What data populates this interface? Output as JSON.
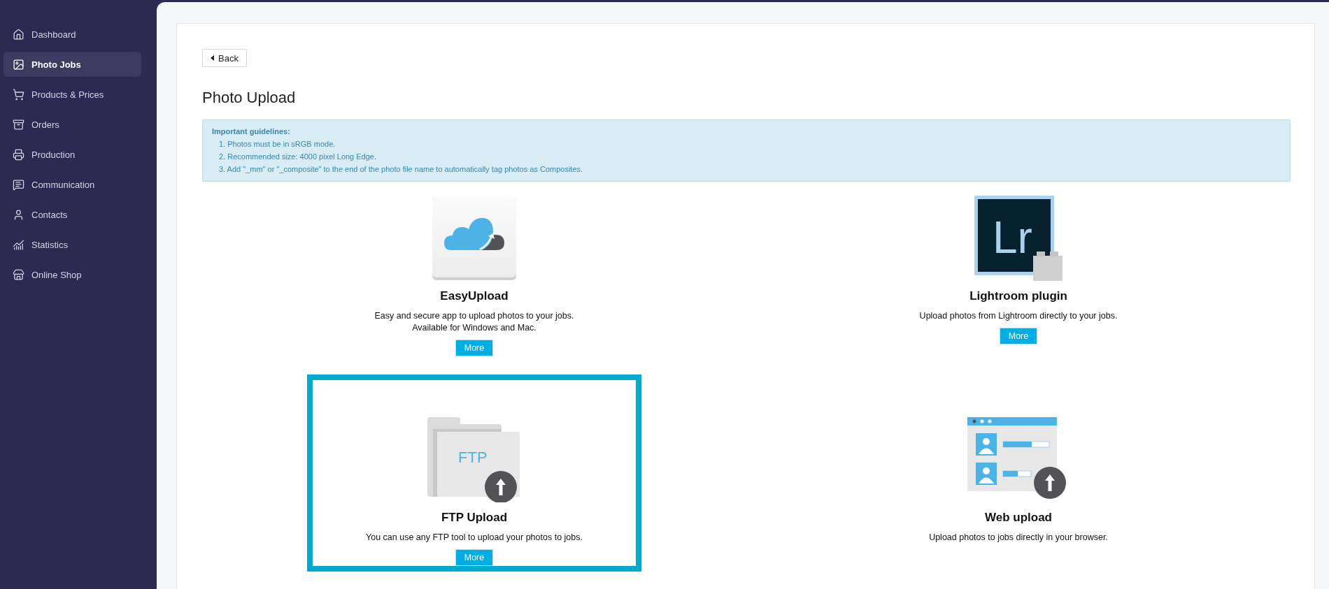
{
  "sidebar": {
    "items": [
      {
        "kind": "home",
        "label": "Dashboard",
        "selected": false
      },
      {
        "kind": "image",
        "label": "Photo Jobs",
        "selected": true
      },
      {
        "kind": "cart",
        "label": "Products & Prices",
        "selected": false
      },
      {
        "kind": "box",
        "label": "Orders",
        "selected": false
      },
      {
        "kind": "printer",
        "label": "Production",
        "selected": false
      },
      {
        "kind": "message",
        "label": "Communication",
        "selected": false
      },
      {
        "kind": "user",
        "label": "Contacts",
        "selected": false
      },
      {
        "kind": "chart",
        "label": "Statistics",
        "selected": false
      },
      {
        "kind": "store",
        "label": "Online Shop",
        "selected": false
      }
    ]
  },
  "back_button": {
    "label": "Back"
  },
  "title": "Photo Upload",
  "guidelines": {
    "heading": "Important guidelines:",
    "items": [
      "1. Photos must be in sRGB mode.",
      "2. Recommended size: 4000 pixel Long Edge.",
      "3. Add \"_mm\" or \"_composite\" to the end of the photo file name to automatically tag photos as Composites."
    ]
  },
  "options": [
    {
      "kind": "cloud",
      "title": "EasyUpload",
      "description": [
        "Easy and secure app to upload photos to your jobs.",
        "Available for Windows and Mac."
      ],
      "button": "More",
      "highlighted": false
    },
    {
      "kind": "lightroom",
      "icon_text": "Lr",
      "title": "Lightroom plugin",
      "description": [
        "Upload photos from Lightroom directly to your jobs."
      ],
      "button": "More",
      "highlighted": false
    },
    {
      "kind": "ftp",
      "icon_text": "FTP",
      "title": "FTP Upload",
      "description": [
        "You can use any FTP tool to upload your photos to jobs."
      ],
      "button": "More",
      "highlighted": true
    },
    {
      "kind": "web",
      "title": "Web upload",
      "description": [
        "Upload photos to jobs directly in your browser."
      ],
      "highlighted": false
    }
  ]
}
